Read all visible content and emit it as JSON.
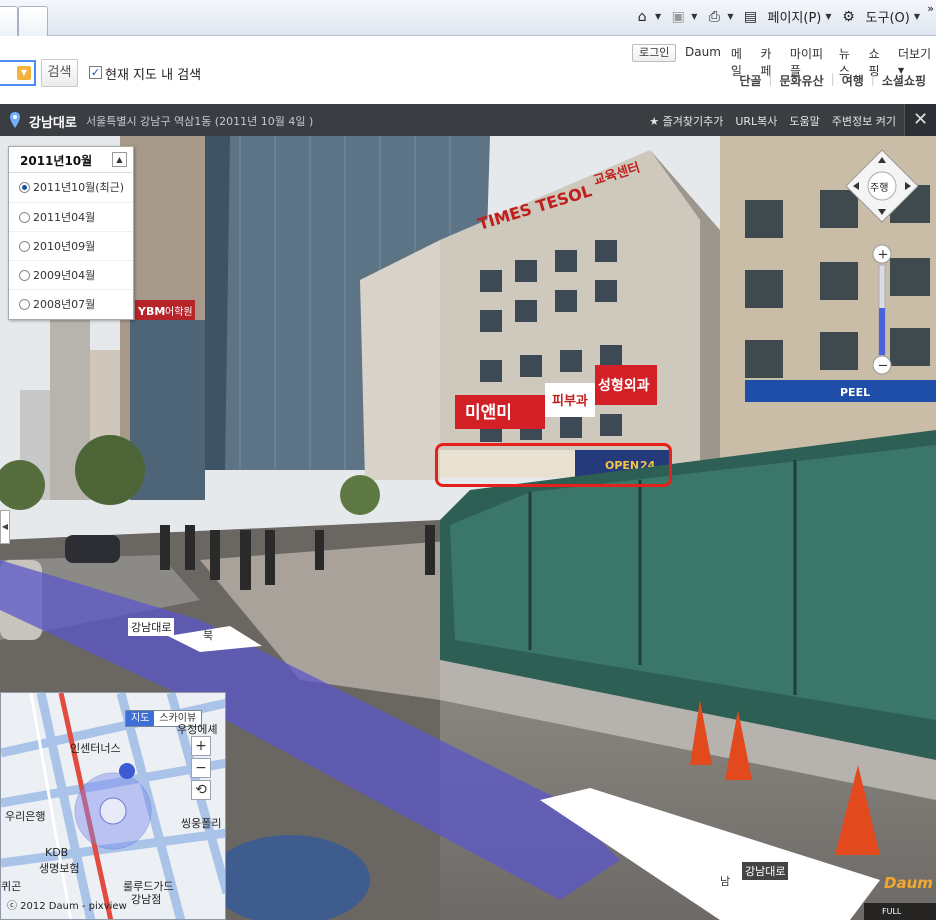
{
  "browser": {
    "tools": {
      "page_label": "페이지(P)",
      "tools_label": "도구(O)",
      "more": "»"
    },
    "icons": [
      "home-icon",
      "feed-icon",
      "print-icon",
      "page-icon",
      "gear-icon"
    ]
  },
  "header": {
    "search_button": "검색",
    "checkbox_checked": true,
    "checkbox_label": "현재 지도 내 검색",
    "login": "로그인",
    "top_nav": [
      "Daum",
      "메일",
      "카페",
      "마이피플",
      "뉴스",
      "쇼핑",
      "더보기"
    ],
    "sub_nav": [
      "단골",
      "문화유산",
      "여행",
      "소셜쇼핑"
    ]
  },
  "roadview": {
    "title": "강남대로",
    "address": "서울특별시 강남구 역삼1동 (2011년 10월 4일 )",
    "links": [
      "즐겨찾기추가",
      "URL복사",
      "도움말",
      "주변정보 켜기"
    ],
    "close": "✕"
  },
  "date_panel": {
    "header": "2011년10월",
    "items": [
      {
        "label": "2011년10월(최근)",
        "selected": true
      },
      {
        "label": "2011년04월",
        "selected": false
      },
      {
        "label": "2010년09월",
        "selected": false
      },
      {
        "label": "2009년04월",
        "selected": false
      },
      {
        "label": "2008년07월",
        "selected": false
      }
    ]
  },
  "nav_control": {
    "center": "주행"
  },
  "scene_labels": {
    "road_north": "강남대로",
    "north": "북",
    "road_south": "강남대로",
    "south": "남",
    "sign_times": "TIMES TESOL",
    "sign_center": "교육센터",
    "sign_mianmi": "미앤미",
    "sign_derm": "피부과",
    "sign_plastic": "성형외과",
    "sign_open": "OPEN",
    "sign_24": "24",
    "sign_ybm": "YBM",
    "sign_ybm_kr": "어학원",
    "sign_meg": "PEEL"
  },
  "minimap": {
    "tabs": [
      "지도",
      "스카이뷰"
    ],
    "active_tab": "지도",
    "zoom_in": "+",
    "zoom_out": "−",
    "reset": "⟲",
    "labels": [
      "인센터너스",
      "우리은행",
      "KDB",
      "생명보험",
      "씽웅폴리",
      "우정에셰",
      "룰루드가드",
      "강남점",
      "퀴곤"
    ],
    "copyright": "ⓒ 2012 Daum - pixview"
  },
  "logo": "Daum",
  "fullscreen": "FULL SCREEN",
  "colors": {
    "roadview_bar": "#3a3d42",
    "highlight_box": "#e8201a",
    "road_path": "#5b57c9",
    "active_tab": "#3d6fd6"
  }
}
